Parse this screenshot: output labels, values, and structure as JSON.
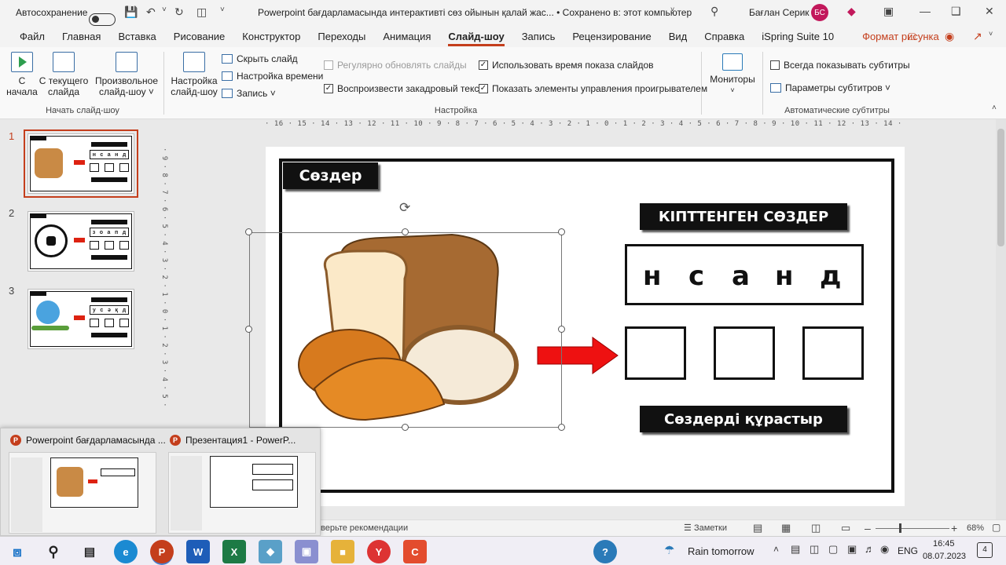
{
  "titlebar": {
    "autosave_label": "Автосохранение",
    "title": "Powerpoint бағдарламасында интерактивті сөз ойынын қалай жас...  •  Сохранено в: этот компьютер",
    "user_name": "Бағлан Серик",
    "user_initials": "БС"
  },
  "tabs": [
    "Файл",
    "Главная",
    "Вставка",
    "Рисование",
    "Конструктор",
    "Переходы",
    "Анимация",
    "Слайд-шоу",
    "Запись",
    "Рецензирование",
    "Вид",
    "Справка",
    "iSpring Suite 10",
    "Формат рисунка"
  ],
  "active_tab": "Слайд-шоу",
  "ribbon": {
    "from_start_1": "С",
    "from_start_2": "начала",
    "from_current_1": "С текущего",
    "from_current_2": "слайда",
    "custom_1": "Произвольное",
    "custom_2": "слайд-шоу ˅",
    "setup_1": "Настройка",
    "setup_2": "слайд-шоу",
    "hide_slide": "Скрыть слайд",
    "rehearse": "Настройка времени",
    "record": "Запись  ˅",
    "auto_update": "Регулярно обновлять слайды",
    "play_narration": "Воспроизвести закадровый текст",
    "use_timings": "Использовать время показа слайдов",
    "show_controls": "Показать элементы управления проигрывателем",
    "monitors": "Мониторы",
    "always_subtitles": "Всегда показывать субтитры",
    "subtitle_settings": "Параметры субтитров ˅",
    "group_start": "Начать слайд-шоу",
    "group_setup": "Настройка",
    "group_captions": "Автоматические субтитры"
  },
  "ruler_top": "· 16 · 15 · 14 · 13 · 12 · 11 · 10 · 9 · 8 · 7 · 6 · 5 · 4 · 3 · 2 · 1 · 0 · 1 · 2 · 3 · 4 · 5 · 6 · 7 · 8 · 9 · 10 · 11 · 12 · 13 · 14 · 15 · 16 ·",
  "ruler_left": "· 9 · 8 · 7 · 6 · 5 · 4 · 3 · 2 · 1 · 0 · 1 · 2 · 3 · 4 · 5 ·",
  "thumbnails": [
    {
      "num": "1"
    },
    {
      "num": "2"
    },
    {
      "num": "3"
    }
  ],
  "thumb_letters": {
    "1": [
      "н",
      "с",
      "а",
      "н",
      "д"
    ],
    "2": [
      "з",
      "о",
      "а",
      "п",
      "д"
    ],
    "3": [
      "у",
      "с",
      "ә",
      "қ",
      "д"
    ]
  },
  "slide": {
    "title_tag": "Сөздер",
    "header": "КІПТТЕНГЕН СӨЗДЕР",
    "letters": [
      "н",
      "с",
      "а",
      "н",
      "д"
    ],
    "footer": "Сөздерді құрастыр"
  },
  "preview": {
    "item1": "Powerpoint бағдарламасында ...",
    "item2": "Презентация1 - PowerP..."
  },
  "status": {
    "left": "верьте рекомендации",
    "notes": "Заметки",
    "zoom": "68%"
  },
  "taskbar": {
    "weather": "Rain tomorrow",
    "lang": "ENG",
    "time": "16:45",
    "date": "08.07.2023",
    "notifications": "4"
  }
}
